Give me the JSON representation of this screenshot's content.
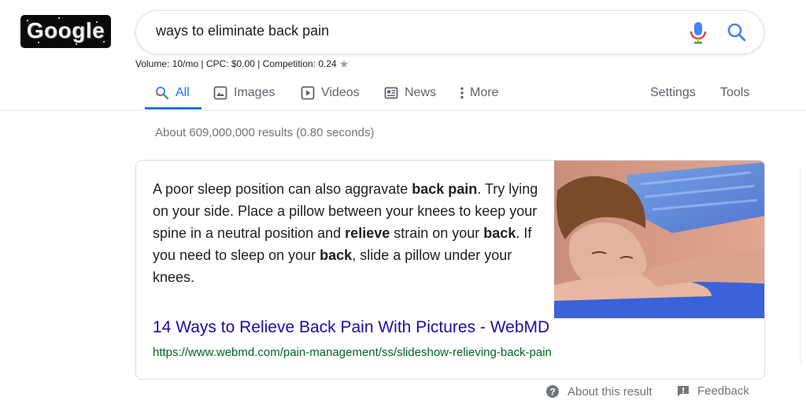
{
  "logo": {
    "text": "Google"
  },
  "search": {
    "query": "ways to eliminate back pain",
    "mic_icon": "microphone-icon",
    "search_icon": "magnifier-icon"
  },
  "keyword_stats": {
    "text": "Volume: 10/mo | CPC: $0.00 | Competition: 0.24",
    "star_icon": "star-icon"
  },
  "tabs": [
    {
      "label": "All",
      "icon": "search-icon",
      "active": true
    },
    {
      "label": "Images",
      "icon": "image-icon"
    },
    {
      "label": "Videos",
      "icon": "play-icon"
    },
    {
      "label": "News",
      "icon": "newspaper-icon"
    },
    {
      "label": "More",
      "icon": "more-vert-icon"
    },
    {
      "label": "Settings"
    },
    {
      "label": "Tools"
    }
  ],
  "result_stats": "About 609,000,000 results (0.80 seconds)",
  "featured_snippet": {
    "text_parts": [
      {
        "text": "A poor sleep position can also aggravate ",
        "bold": false
      },
      {
        "text": "back pain",
        "bold": true
      },
      {
        "text": ". Try lying on your side. Place a pillow between your knees to keep your spine in a neutral position and ",
        "bold": false
      },
      {
        "text": "relieve",
        "bold": true
      },
      {
        "text": " strain on your ",
        "bold": false
      },
      {
        "text": "back",
        "bold": true
      },
      {
        "text": ". If you need to sleep on your ",
        "bold": false
      },
      {
        "text": "back",
        "bold": true
      },
      {
        "text": ", slide a pillow under your knees.",
        "bold": false
      }
    ],
    "image": "woman-lying-with-ice-pack-on-back-photo",
    "title": "14 Ways to Relieve Back Pain With Pictures - WebMD",
    "url": "https://www.webmd.com/pain-management/ss/slideshow-relieving-back-pain"
  },
  "footer": {
    "about_label": "About this result",
    "about_icon": "help-circle-icon",
    "feedback_label": "Feedback",
    "feedback_icon": "feedback-icon"
  },
  "colors": {
    "accent": "#1a73e8",
    "link": "#1a0dab",
    "url": "#006621",
    "muted": "#70757a"
  }
}
